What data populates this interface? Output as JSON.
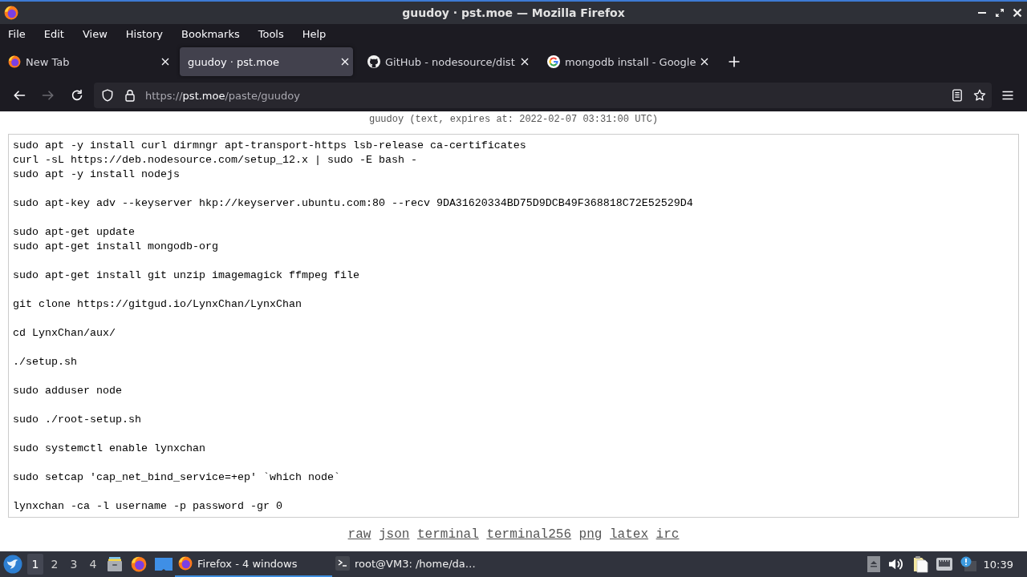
{
  "window": {
    "title": "guudoy · pst.moe — Mozilla Firefox"
  },
  "menu": [
    "File",
    "Edit",
    "View",
    "History",
    "Bookmarks",
    "Tools",
    "Help"
  ],
  "tabs": [
    {
      "label": "New Tab",
      "kind": "browser",
      "selected": false
    },
    {
      "label": "guudoy · pst.moe",
      "kind": "plain",
      "selected": true
    },
    {
      "label": "GitHub - nodesource/dist",
      "kind": "repo",
      "selected": false
    },
    {
      "label": "mongodb install - Google",
      "kind": "search",
      "selected": false
    }
  ],
  "navigation": {
    "buttons": [
      {
        "kind": "back",
        "disabled": false
      },
      {
        "kind": "forward",
        "disabled": true
      },
      {
        "kind": "reload",
        "disabled": false
      }
    ],
    "url": {
      "scheme": "https://",
      "host": "pst.moe",
      "path": "/paste/guudoy"
    }
  },
  "paste": {
    "info": "guudoy (text, expires at: 2022-02-07 03:31:00 UTC)",
    "blocks": [
      {
        "lines": [
          "sudo apt -y install curl dirmngr apt-transport-https lsb-release ca-certificates",
          "curl -sL https://deb.nodesource.com/setup_12.x | sudo -E bash -",
          "sudo apt -y install nodejs"
        ]
      },
      {
        "lines": [
          "sudo apt-key adv --keyserver hkp://keyserver.ubuntu.com:80 --recv 9DA31620334BD75D9DCB49F368818C72E52529D4"
        ]
      },
      {
        "lines": [
          "sudo apt-get update",
          "sudo apt-get install mongodb-org"
        ]
      },
      {
        "lines": [
          "sudo apt-get install git unzip imagemagick ffmpeg file"
        ]
      },
      {
        "lines": [
          "git clone https://gitgud.io/LynxChan/LynxChan"
        ]
      },
      {
        "lines": [
          "cd LynxChan/aux/"
        ]
      },
      {
        "lines": [
          "./setup.sh"
        ]
      },
      {
        "lines": [
          "sudo adduser node"
        ]
      },
      {
        "lines": [
          "sudo ./root-setup.sh"
        ]
      },
      {
        "lines": [
          "sudo systemctl enable lynxchan"
        ]
      },
      {
        "lines": [
          "sudo setcap 'cap_net_bind_service=+ep' `which node`"
        ]
      },
      {
        "lines": [
          "lynxchan -ca -l username -p password -gr 0"
        ]
      }
    ],
    "formats": [
      "raw",
      "json",
      "terminal",
      "terminal256",
      "png",
      "latex",
      "irc"
    ]
  },
  "taskbar": {
    "workspaces": [
      {
        "label": "1",
        "selected": true
      },
      {
        "label": "2",
        "selected": false
      },
      {
        "label": "3",
        "selected": false
      },
      {
        "label": "4",
        "selected": false
      }
    ],
    "tasks": [
      {
        "label": "Firefox - 4 windows",
        "kind": "browser",
        "selected": true
      },
      {
        "label": "root@VM3: /home/da…",
        "kind": "terminal",
        "selected": false
      }
    ],
    "clock": "10:39"
  }
}
